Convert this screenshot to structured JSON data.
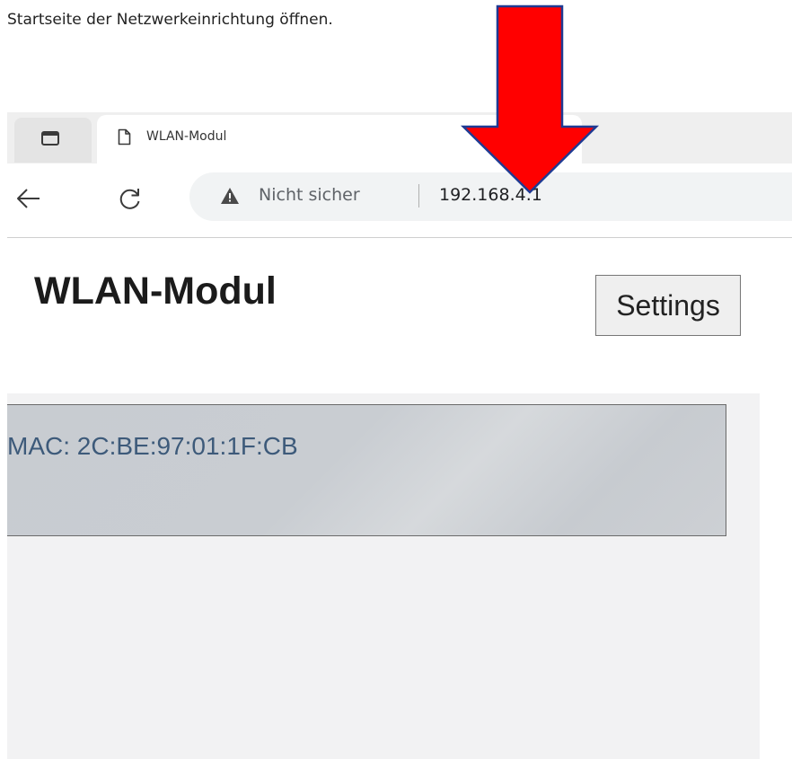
{
  "caption": "Startseite der Netzwerkeinrichtung öffnen.",
  "browser": {
    "tab_title": "WLAN-Modul",
    "security_label": "Nicht sicher",
    "url": "192.168.4.1"
  },
  "page": {
    "title": "WLAN-Modul",
    "settings_label": "Settings",
    "mac_line": "MAC: 2C:BE:97:01:1F:CB"
  },
  "colors": {
    "annotation_arrow": "#ff0000",
    "arrow_outline": "#1f3a93",
    "mac_text": "#3d5a7a"
  },
  "icons": {
    "tab_overview": "tab-overview-icon",
    "tab_page": "page-icon",
    "back": "back-arrow-icon",
    "reload": "reload-icon",
    "security": "warning-icon"
  }
}
